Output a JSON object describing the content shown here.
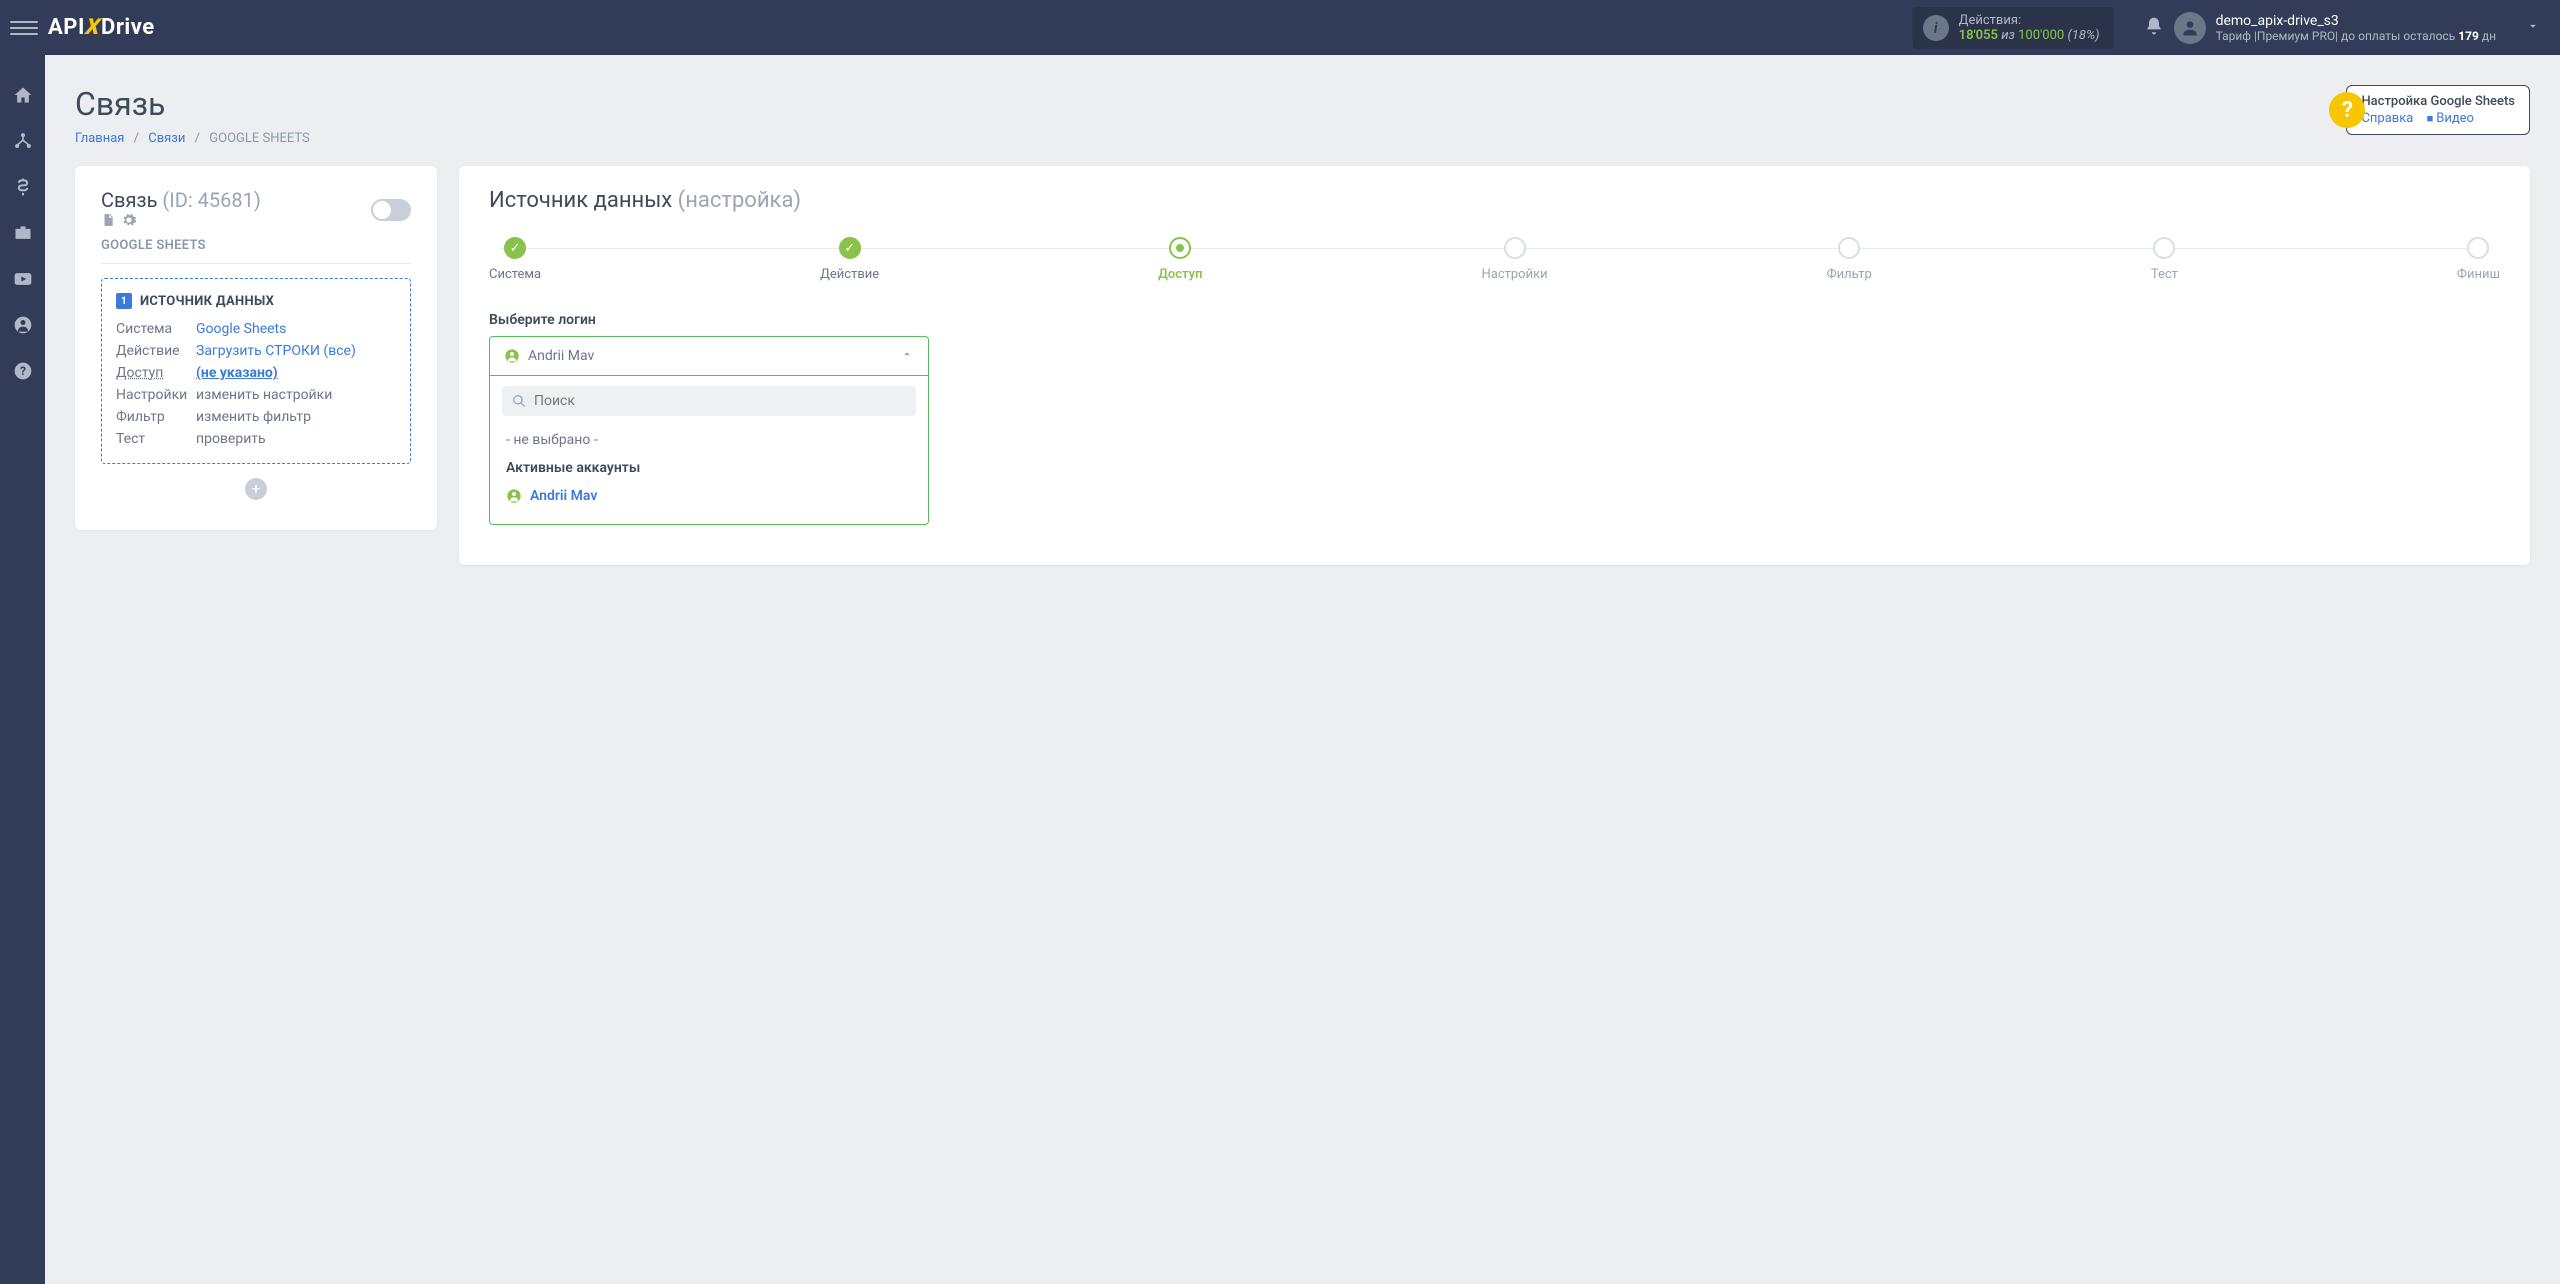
{
  "topbar": {
    "logo_pre": "API",
    "logo_x": "X",
    "logo_post": "Drive",
    "actions_label": "Действия:",
    "actions_used": "18'055",
    "actions_iz": "из",
    "actions_limit": "100'000",
    "actions_pct": "(18%)",
    "username": "demo_apix-drive_s3",
    "tariff_prefix": "Тариф |Премиум PRO| до оплаты осталось ",
    "tariff_days": "179",
    "tariff_suffix": " дн"
  },
  "page": {
    "title": "Связь",
    "breadcrumb": {
      "home": "Главная",
      "links": "Связи",
      "current": "GOOGLE SHEETS"
    },
    "help": {
      "title": "Настройка Google Sheets",
      "ref": "Справка",
      "video": "Видео"
    }
  },
  "left": {
    "title_label": "Связь",
    "title_id": "(ID: 45681)",
    "subtitle": "GOOGLE SHEETS",
    "source_heading": "ИСТОЧНИК ДАННЫХ",
    "rows": {
      "system_label": "Система",
      "system_value": "Google Sheets",
      "action_label": "Действие",
      "action_value": "Загрузить СТРОКИ (все)",
      "access_label": "Доступ",
      "access_value": "(не указано)",
      "settings_label": "Настройки",
      "settings_value": "изменить настройки",
      "filter_label": "Фильтр",
      "filter_value": "изменить фильтр",
      "test_label": "Тест",
      "test_value": "проверить"
    }
  },
  "right": {
    "title_main": "Источник данных",
    "title_sub": "(настройка)",
    "steps": [
      "Система",
      "Действие",
      "Доступ",
      "Настройки",
      "Фильтр",
      "Тест",
      "Финиш"
    ],
    "field_label": "Выберите логин",
    "selected_value": "Andrii Mav",
    "search_placeholder": "Поиск",
    "none_option": "- не выбрано -",
    "group_label": "Активные аккаунты",
    "option1": "Andrii Mav"
  }
}
